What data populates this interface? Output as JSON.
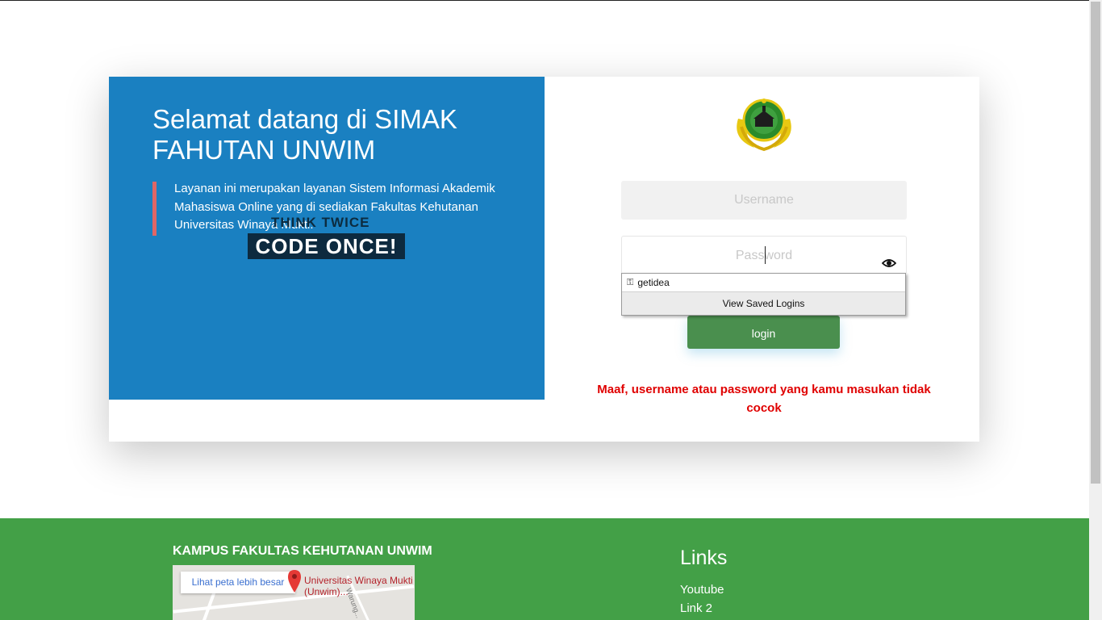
{
  "welcome": {
    "title": "Selamat datang di SIMAK FAHUTAN UNWIM",
    "description": "Layanan ini merupakan layanan Sistem Informasi Akademik Mahasiswa Online yang di sediakan Fakultas Kehutanan Universitas Winaya Mukti.",
    "sticker_top": "THINK TWICE",
    "sticker_bottom": "CODE ONCE!"
  },
  "login_form": {
    "logo_icon": "university-emblem",
    "username_placeholder": "Username",
    "password_placeholder": "Password",
    "toggle_icon": "eye-icon",
    "submit_label": "login",
    "error_message": "Maaf, username atau password yang kamu masukan tidak cocok"
  },
  "autofill": {
    "items": [
      {
        "label": "getidea",
        "icon": "key-icon"
      }
    ],
    "footer_label": "View Saved Logins"
  },
  "footer": {
    "campus_title": "KAMPUS FAKULTAS KEHUTANAN UNWIM",
    "map_button": "Lihat peta lebih besar",
    "map_place": "Universitas Winaya Mukti (Unwim)...",
    "map_road_label": "Warung...",
    "links_title": "Links",
    "links": [
      "Youtube",
      "Link 2"
    ]
  },
  "colors": {
    "panel_blue": "#1a80c1",
    "footer_green": "#43a047",
    "button_green": "#4a8f4e",
    "error_red": "#e00000"
  }
}
